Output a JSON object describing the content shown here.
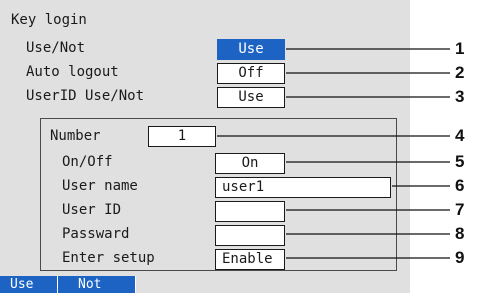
{
  "title": "Key login",
  "rows_top": [
    {
      "label": "Use/Not",
      "value": "Use",
      "selected": true
    },
    {
      "label": "Auto logout",
      "value": "Off",
      "selected": false
    },
    {
      "label": "UserID Use/Not",
      "value": "Use",
      "selected": false
    }
  ],
  "group": {
    "number_label": "Number",
    "number_value": "1",
    "rows": [
      {
        "label": "On/Off",
        "value": "On"
      },
      {
        "label": "User name",
        "value": "user1"
      },
      {
        "label": "User ID",
        "value": ""
      },
      {
        "label": "Passward",
        "value": ""
      },
      {
        "label": "Enter setup",
        "value": "Enable"
      }
    ]
  },
  "softkeys": [
    "Use",
    "Not"
  ],
  "callouts": [
    "1",
    "2",
    "3",
    "4",
    "5",
    "6",
    "7",
    "8",
    "9"
  ],
  "colors": {
    "background": "#e0e0e0",
    "accent": "#1d63c4"
  }
}
